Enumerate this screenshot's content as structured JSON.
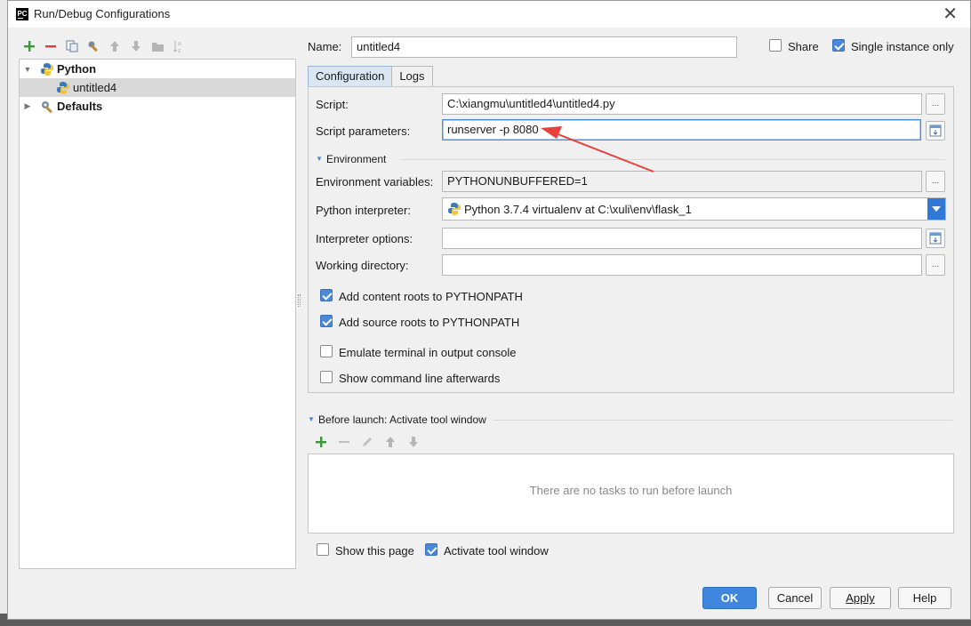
{
  "window": {
    "title": "Run/Debug Configurations",
    "app_icon": "PC",
    "close_glyph": "✕"
  },
  "tree": {
    "items": [
      {
        "label": "Python",
        "icon": "python-icon",
        "expanded": true,
        "bold": true
      },
      {
        "label": "untitled4",
        "icon": "python-file-icon",
        "selected": true
      },
      {
        "label": "Defaults",
        "icon": "wrench-icon",
        "expanded": false,
        "bold": true
      }
    ]
  },
  "name": {
    "label": "Name:",
    "value": "untitled4"
  },
  "share": {
    "label": "Share",
    "checked": false
  },
  "single_instance": {
    "label": "Single instance only",
    "checked": true
  },
  "tabs": [
    {
      "label": "Configuration",
      "active": true
    },
    {
      "label": "Logs",
      "active": false
    }
  ],
  "fields": {
    "script": {
      "label": "Script:",
      "value": "C:\\xiangmu\\untitled4\\untitled4.py"
    },
    "script_params": {
      "label": "Script parameters:",
      "value": "runserver -p 8080"
    },
    "environment_section": "Environment",
    "env_vars": {
      "label": "Environment variables:",
      "value": "PYTHONUNBUFFERED=1"
    },
    "interpreter": {
      "label": "Python interpreter:",
      "value": "Python 3.7.4 virtualenv at C:\\xuli\\env\\flask_1"
    },
    "interpreter_options": {
      "label": "Interpreter options:",
      "value": ""
    },
    "working_dir": {
      "label": "Working directory:",
      "value": ""
    }
  },
  "checks": [
    {
      "label": "Add content roots to PYTHONPATH",
      "checked": true
    },
    {
      "label": "Add source roots to PYTHONPATH",
      "checked": true
    },
    {
      "label": "Emulate terminal in output console",
      "checked": false
    },
    {
      "label": "Show command line afterwards",
      "checked": false
    }
  ],
  "before_launch": {
    "title": "Before launch: Activate tool window",
    "empty_message": "There are no tasks to run before launch"
  },
  "show_this_page": {
    "label": "Show this page",
    "checked": false
  },
  "activate_tool_window": {
    "label": "Activate tool window",
    "checked": true
  },
  "buttons": {
    "ok": "OK",
    "cancel": "Cancel",
    "apply": "Apply",
    "help": "Help"
  },
  "browse_glyph": "...",
  "colors": {
    "accent": "#3f86de",
    "annotation_arrow": "#e8403a"
  }
}
